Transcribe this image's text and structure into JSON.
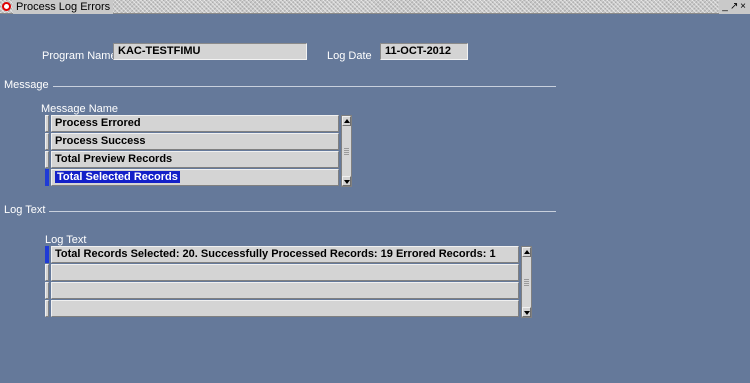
{
  "window": {
    "title": "Process Log Errors",
    "controls": [
      "_",
      "↗",
      "×"
    ]
  },
  "header": {
    "program_label": "Program Name",
    "program_value": "KAC-TESTFIMU",
    "logdate_label": "Log Date",
    "logdate_value": "11-OCT-2012"
  },
  "message_section": {
    "title": "Message",
    "column_label": "Message Name",
    "rows": [
      "Process Errored",
      "Process Success",
      "Total Preview Records",
      "Total Selected Records"
    ],
    "selected_index": 3
  },
  "logtext_section": {
    "title": "Log Text",
    "column_label": "Log Text",
    "rows": [
      "Total Records Selected: 20. Successfully Processed Records: 19 Errored Records:  1",
      "",
      "",
      ""
    ]
  },
  "colors": {
    "background": "#65799a",
    "field": "#d4d4d4",
    "selection": "#1320c8"
  }
}
